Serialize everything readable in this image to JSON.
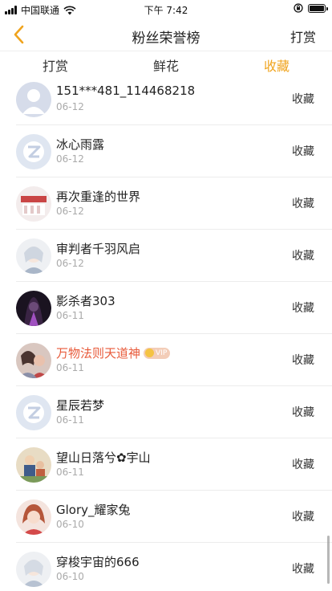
{
  "status_bar": {
    "carrier": "中国联通",
    "time": "下午 7:42"
  },
  "nav": {
    "title": "粉丝荣誉榜",
    "action_label": "打赏"
  },
  "tabs": [
    {
      "label": "打赏",
      "active": false
    },
    {
      "label": "鲜花",
      "active": false
    },
    {
      "label": "收藏",
      "active": true
    }
  ],
  "colors": {
    "accent": "#f0a41e",
    "highlight_name": "#e85a3a"
  },
  "list": {
    "items": [
      {
        "name": "151***481_114468218",
        "date": "06-12",
        "action": "收藏",
        "avatar": "default-person-avatar"
      },
      {
        "name": "冰心雨露",
        "date": "06-12",
        "action": "收藏",
        "avatar": "default-z-avatar"
      },
      {
        "name": "再次重逢的世界",
        "date": "06-12",
        "action": "收藏",
        "avatar": "photo-avatar"
      },
      {
        "name": "审判者千羽风启",
        "date": "06-12",
        "action": "收藏",
        "avatar": "anime-avatar"
      },
      {
        "name": "影杀者303",
        "date": "06-11",
        "action": "收藏",
        "avatar": "dark-avatar"
      },
      {
        "name": "万物法则天道神",
        "date": "06-11",
        "action": "收藏",
        "avatar": "photo-avatar",
        "vip": "VIP",
        "highlight": true
      },
      {
        "name": "星辰若梦",
        "date": "06-11",
        "action": "收藏",
        "avatar": "default-z-avatar"
      },
      {
        "name": "望山日落兮✿宇山",
        "date": "06-11",
        "action": "收藏",
        "avatar": "photo-avatar"
      },
      {
        "name": "Glory_耀家兔",
        "date": "06-10",
        "action": "收藏",
        "avatar": "anime-avatar"
      },
      {
        "name": "穿梭宇宙的666",
        "date": "06-10",
        "action": "收藏",
        "avatar": "anime-avatar"
      }
    ]
  }
}
